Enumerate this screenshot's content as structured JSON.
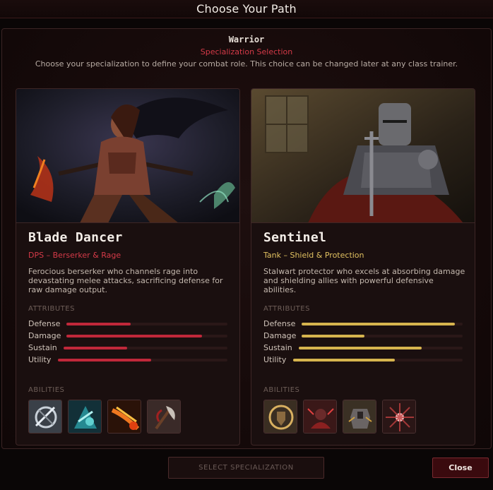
{
  "window": {
    "title": "Choose Your Path"
  },
  "header": {
    "class_name": "Warrior",
    "subtitle": "Specialization Selection",
    "description": "Choose your specialization to define your combat role. This choice can be changed later at any class trainer."
  },
  "labels": {
    "attributes": "ATTRIBUTES",
    "abilities": "ABILITIES"
  },
  "specs": [
    {
      "name": "Blade Dancer",
      "role": "DPS – Berserker & Rage",
      "description": "Ferocious berserker who channels rage into devastating melee attacks, sacrificing defense for raw damage output.",
      "accent": "#c0283a",
      "attributes": [
        {
          "label": "Defense",
          "value": 0.4
        },
        {
          "label": "Damage",
          "value": 0.84
        },
        {
          "label": "Sustain",
          "value": 0.39
        },
        {
          "label": "Utility",
          "value": 0.55
        }
      ],
      "abilities": [
        "whirlwind-icon",
        "frost-strike-icon",
        "fire-slash-icon",
        "axe-icon"
      ]
    },
    {
      "name": "Sentinel",
      "role": "Tank – Shield & Protection",
      "description": "Stalwart protector who excels at absorbing damage and shielding allies with powerful defensive abilities.",
      "accent": "#d6b44e",
      "attributes": [
        {
          "label": "Defense",
          "value": 0.95
        },
        {
          "label": "Damage",
          "value": 0.39
        },
        {
          "label": "Sustain",
          "value": 0.75
        },
        {
          "label": "Utility",
          "value": 0.6
        }
      ],
      "abilities": [
        "shield-wall-icon",
        "taunt-icon",
        "armor-icon",
        "shield-bash-icon"
      ]
    }
  ],
  "footer": {
    "select_label": "SELECT SPECIALIZATION",
    "close_label": "Close"
  }
}
